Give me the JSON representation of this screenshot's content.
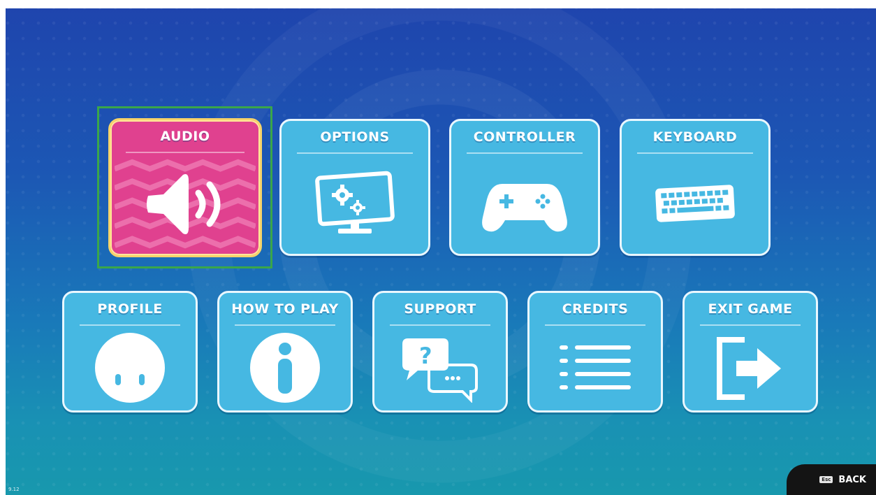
{
  "menu": {
    "row1": [
      {
        "key": "audio",
        "label": "AUDIO",
        "icon": "speaker-icon",
        "selected": true
      },
      {
        "key": "options",
        "label": "OPTIONS",
        "icon": "monitor-gears-icon",
        "selected": false
      },
      {
        "key": "controller",
        "label": "CONTROLLER",
        "icon": "gamepad-icon",
        "selected": false
      },
      {
        "key": "keyboard",
        "label": "KEYBOARD",
        "icon": "keyboard-icon",
        "selected": false
      }
    ],
    "row2": [
      {
        "key": "profile",
        "label": "PROFILE",
        "icon": "profile-face-icon",
        "selected": false
      },
      {
        "key": "how_to_play",
        "label": "HOW TO PLAY",
        "icon": "info-icon",
        "selected": false
      },
      {
        "key": "support",
        "label": "SUPPORT",
        "icon": "chat-bubbles-icon",
        "selected": false
      },
      {
        "key": "credits",
        "label": "CREDITS",
        "icon": "list-icon",
        "selected": false
      },
      {
        "key": "exit_game",
        "label": "EXIT GAME",
        "icon": "exit-door-icon",
        "selected": false
      }
    ]
  },
  "footer": {
    "back_label": "BACK",
    "back_key_hint": "Esc",
    "version": "9.12"
  },
  "colors": {
    "tile": "#46b8e2",
    "tile_selected": "#e0418f",
    "focus_frame": "#3aa64a",
    "background_top": "#1f44ad",
    "background_bottom": "#1898ad"
  }
}
